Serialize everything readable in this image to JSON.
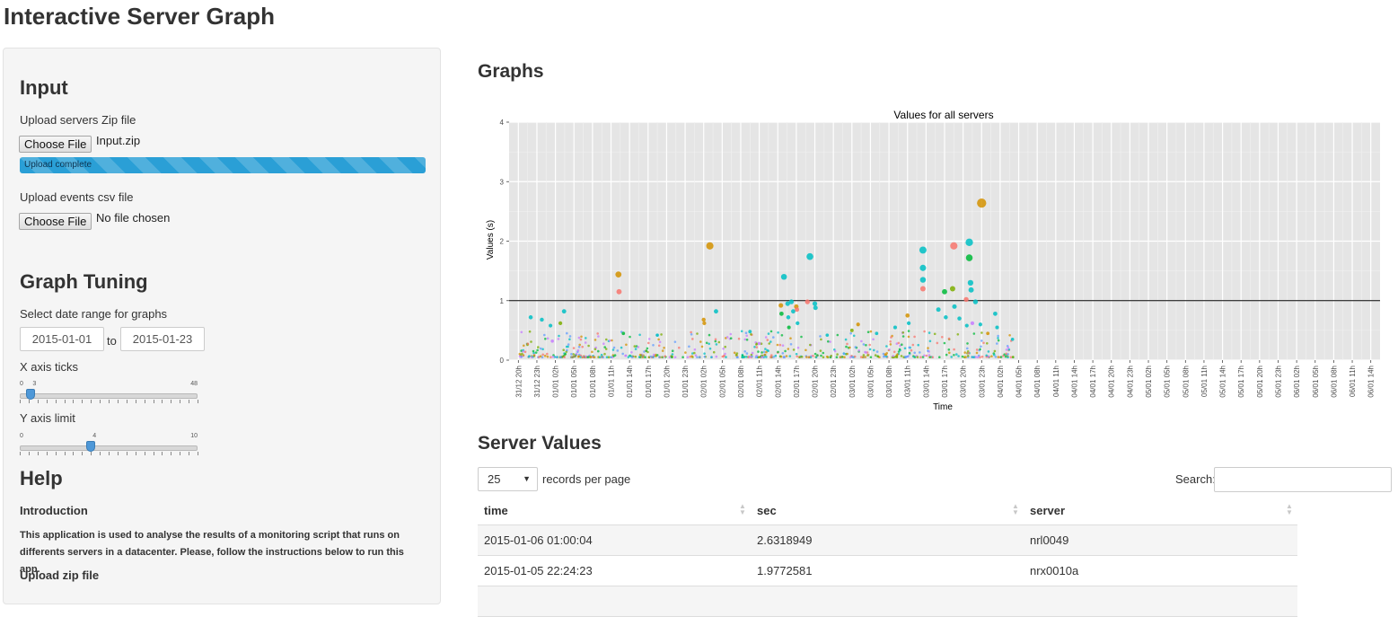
{
  "app": {
    "title": "Interactive Server Graph"
  },
  "sidebar": {
    "input_heading": "Input",
    "zip_upload": {
      "label": "Upload servers Zip file",
      "button": "Choose File",
      "file_name": "Input.zip",
      "progress_text": "Upload complete",
      "progress": 1.0
    },
    "csv_upload": {
      "label": "Upload events csv file",
      "button": "Choose File",
      "file_name": "No file chosen"
    },
    "tuning_heading": "Graph Tuning",
    "date_range": {
      "label": "Select date range for graphs",
      "start": "2015-01-01",
      "separator": "to",
      "end": "2015-01-23"
    },
    "x_ticks": {
      "label": "X axis ticks",
      "min": 0,
      "max": 48,
      "value": 3,
      "min_label": "0",
      "max_label": "48",
      "value_label": "3"
    },
    "y_limit": {
      "label": "Y axis limit",
      "min": 0,
      "max": 10,
      "value": 4,
      "min_label": "0",
      "max_label": "10",
      "value_label": "4"
    },
    "help_heading": "Help",
    "intro_heading": "Introduction",
    "intro_text": "This application is used to analyse the results of a monitoring script that runs on differents servers in a datacenter. Please, follow the instructions below to run this app.",
    "upload_zip_heading": "Upload zip file"
  },
  "main": {
    "graphs_heading": "Graphs",
    "values_heading": "Server Values",
    "table": {
      "length_value": "25",
      "length_text": "records per page",
      "search_label": "Search:",
      "columns": [
        "time",
        "sec",
        "server"
      ],
      "rows": [
        [
          "2015-01-06 01:00:04",
          "2.6318949",
          "nrl0049"
        ],
        [
          "2015-01-05 22:24:23",
          "1.9772581",
          "nrx0010a"
        ]
      ]
    }
  },
  "chart_data": {
    "type": "scatter",
    "title": "Values for all servers",
    "xlabel": "Time",
    "ylabel": "Values (s)",
    "ylim": [
      0,
      4
    ],
    "yticks": [
      0,
      1,
      2,
      3,
      4
    ],
    "threshold_line": 1,
    "grid": true,
    "xticks": [
      "31/12 20h",
      "31/12 23h",
      "01/01 02h",
      "01/01 05h",
      "01/01 08h",
      "01/01 11h",
      "01/01 14h",
      "01/01 17h",
      "01/01 20h",
      "01/01 23h",
      "02/01 02h",
      "02/01 05h",
      "02/01 08h",
      "02/01 11h",
      "02/01 14h",
      "02/01 17h",
      "02/01 20h",
      "02/01 23h",
      "03/01 02h",
      "03/01 05h",
      "03/01 08h",
      "03/01 11h",
      "03/01 14h",
      "03/01 17h",
      "03/01 20h",
      "03/01 23h",
      "04/01 02h",
      "04/01 05h",
      "04/01 08h",
      "04/01 11h",
      "04/01 14h",
      "04/01 17h",
      "04/01 20h",
      "04/01 23h",
      "05/01 02h",
      "05/01 05h",
      "05/01 08h",
      "05/01 11h",
      "05/01 14h",
      "05/01 17h",
      "05/01 20h",
      "05/01 23h",
      "06/01 02h",
      "06/01 05h",
      "06/01 08h",
      "06/01 11h",
      "06/01 14h"
    ],
    "x_unit": "hours since 31/12 20h",
    "points": [
      {
        "x": 2.0,
        "y": 0.72,
        "color": "#00bfc4"
      },
      {
        "x": 3.8,
        "y": 0.68,
        "color": "#00bfc4"
      },
      {
        "x": 5.2,
        "y": 0.58,
        "color": "#00bfc4"
      },
      {
        "x": 5.5,
        "y": 0.32,
        "color": "#c77cff"
      },
      {
        "x": 6.8,
        "y": 0.62,
        "color": "#7cae00"
      },
      {
        "x": 7.4,
        "y": 0.82,
        "color": "#00bfc4"
      },
      {
        "x": 16.2,
        "y": 1.44,
        "color": "#d39200"
      },
      {
        "x": 16.3,
        "y": 1.15,
        "color": "#f8766d"
      },
      {
        "x": 17.0,
        "y": 0.45,
        "color": "#00ba38"
      },
      {
        "x": 22.5,
        "y": 0.42,
        "color": "#00bfc4"
      },
      {
        "x": 30.0,
        "y": 0.68,
        "color": "#d39200"
      },
      {
        "x": 30.1,
        "y": 0.62,
        "color": "#d39200"
      },
      {
        "x": 31.0,
        "y": 1.92,
        "color": "#d39200"
      },
      {
        "x": 32.0,
        "y": 0.82,
        "color": "#00bfc4"
      },
      {
        "x": 37.5,
        "y": 0.48,
        "color": "#00bfc4"
      },
      {
        "x": 39.0,
        "y": 0.28,
        "color": "#c77cff"
      },
      {
        "x": 42.5,
        "y": 0.92,
        "color": "#d39200"
      },
      {
        "x": 42.6,
        "y": 0.78,
        "color": "#00ba38"
      },
      {
        "x": 43.0,
        "y": 1.4,
        "color": "#00bfc4"
      },
      {
        "x": 43.6,
        "y": 0.95,
        "color": "#00bfc4"
      },
      {
        "x": 43.7,
        "y": 0.72,
        "color": "#00bfc4"
      },
      {
        "x": 43.8,
        "y": 0.55,
        "color": "#00ba38"
      },
      {
        "x": 44.2,
        "y": 0.98,
        "color": "#00bfc4"
      },
      {
        "x": 44.5,
        "y": 0.82,
        "color": "#00bfc4"
      },
      {
        "x": 45.0,
        "y": 0.9,
        "color": "#d39200"
      },
      {
        "x": 45.1,
        "y": 0.85,
        "color": "#f8766d"
      },
      {
        "x": 45.2,
        "y": 0.62,
        "color": "#00bfc4"
      },
      {
        "x": 46.8,
        "y": 0.98,
        "color": "#f8766d"
      },
      {
        "x": 47.2,
        "y": 1.74,
        "color": "#00bfc4"
      },
      {
        "x": 48.0,
        "y": 0.95,
        "color": "#00bfc4"
      },
      {
        "x": 48.1,
        "y": 0.88,
        "color": "#00bfc4"
      },
      {
        "x": 50.0,
        "y": 0.42,
        "color": "#00bfc4"
      },
      {
        "x": 54.0,
        "y": 0.5,
        "color": "#7cae00"
      },
      {
        "x": 55.0,
        "y": 0.6,
        "color": "#d39200"
      },
      {
        "x": 58.0,
        "y": 0.45,
        "color": "#00bfc4"
      },
      {
        "x": 61.0,
        "y": 0.55,
        "color": "#00bfc4"
      },
      {
        "x": 63.0,
        "y": 0.75,
        "color": "#d39200"
      },
      {
        "x": 63.2,
        "y": 0.62,
        "color": "#00bfc4"
      },
      {
        "x": 65.5,
        "y": 1.85,
        "color": "#00bfc4"
      },
      {
        "x": 65.5,
        "y": 1.55,
        "color": "#00bfc4"
      },
      {
        "x": 65.5,
        "y": 1.35,
        "color": "#00bfc4"
      },
      {
        "x": 65.5,
        "y": 1.2,
        "color": "#f8766d"
      },
      {
        "x": 68.0,
        "y": 0.85,
        "color": "#00bfc4"
      },
      {
        "x": 69.0,
        "y": 1.15,
        "color": "#00ba38"
      },
      {
        "x": 69.2,
        "y": 0.72,
        "color": "#00bfc4"
      },
      {
        "x": 70.3,
        "y": 1.2,
        "color": "#7cae00"
      },
      {
        "x": 70.5,
        "y": 1.92,
        "color": "#f8766d"
      },
      {
        "x": 70.6,
        "y": 0.9,
        "color": "#00bfc4"
      },
      {
        "x": 71.4,
        "y": 0.7,
        "color": "#00bfc4"
      },
      {
        "x": 72.5,
        "y": 1.02,
        "color": "#f8766d"
      },
      {
        "x": 72.6,
        "y": 0.58,
        "color": "#00bfc4"
      },
      {
        "x": 73.0,
        "y": 1.98,
        "color": "#00bfc4"
      },
      {
        "x": 73.0,
        "y": 1.72,
        "color": "#00ba38"
      },
      {
        "x": 73.2,
        "y": 1.3,
        "color": "#00bfc4"
      },
      {
        "x": 73.3,
        "y": 1.18,
        "color": "#00bfc4"
      },
      {
        "x": 73.5,
        "y": 0.62,
        "color": "#c77cff"
      },
      {
        "x": 74.0,
        "y": 0.98,
        "color": "#00bfc4"
      },
      {
        "x": 74.8,
        "y": 0.6,
        "color": "#00bfc4"
      },
      {
        "x": 75.0,
        "y": 2.64,
        "color": "#d39200"
      },
      {
        "x": 76.0,
        "y": 0.45,
        "color": "#d39200"
      },
      {
        "x": 77.2,
        "y": 0.78,
        "color": "#00bfc4"
      },
      {
        "x": 77.5,
        "y": 0.55,
        "color": "#00bfc4"
      },
      {
        "x": 80.0,
        "y": 0.35,
        "color": "#00bfc4"
      }
    ]
  }
}
